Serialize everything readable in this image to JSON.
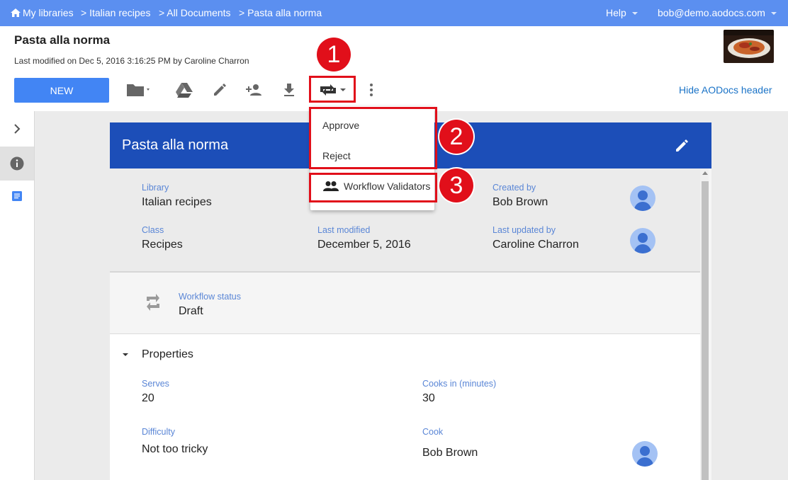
{
  "topbar": {
    "crumbs": [
      "My libraries",
      "> Italian recipes",
      "> All Documents",
      "> Pasta alla norma"
    ],
    "help": "Help",
    "user": "bob@demo.aodocs.com"
  },
  "header": {
    "title": "Pasta alla norma",
    "modified": "Last modified on Dec 5, 2016 3:16:25 PM by Caroline Charron",
    "new_label": "NEW",
    "hide_header": "Hide AODocs header"
  },
  "menu": {
    "items": [
      "Approve",
      "Reject",
      "Workflow Validators"
    ]
  },
  "badges": [
    "1",
    "2",
    "3"
  ],
  "card": {
    "title": "Pasta alla norma",
    "fields": {
      "library_label": "Library",
      "library_value": "Italian recipes",
      "created_label": "Created by",
      "created_value": "Bob Brown",
      "class_label": "Class",
      "class_value": "Recipes",
      "modified_label": "Last modified",
      "modified_value": "December 5, 2016",
      "updated_label": "Last updated by",
      "updated_value": "Caroline Charron"
    },
    "workflow": {
      "label": "Workflow status",
      "value": "Draft"
    },
    "properties": {
      "heading": "Properties",
      "serves_label": "Serves",
      "serves_value": "20",
      "cooks_label": "Cooks in (minutes)",
      "cooks_value": "30",
      "difficulty_label": "Difficulty",
      "difficulty_value": "Not too tricky",
      "cook_label": "Cook",
      "cook_value": "Bob Brown"
    }
  },
  "colors": {
    "topbar": "#5b8ff0",
    "card_header": "#1c4eb8",
    "primary_button": "#4285f4",
    "annotation_red": "#e10f1a",
    "label_blue": "#5a86d6"
  },
  "icons": [
    "home-icon",
    "folder-icon",
    "drive-icon",
    "edit-icon",
    "add-person-icon",
    "download-icon",
    "workflow-icon",
    "more-vert-icon",
    "chevron-right-icon",
    "info-icon",
    "document-icon",
    "people-icon",
    "avatar-icon"
  ]
}
